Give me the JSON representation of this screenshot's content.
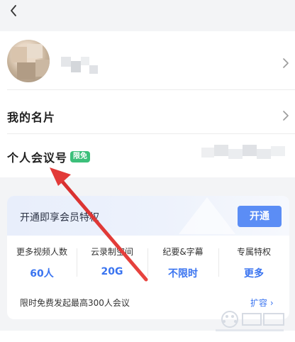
{
  "header": {
    "back_icon": "chevron-left-icon"
  },
  "profile": {
    "name_blurred": true
  },
  "rows": {
    "card_label": "我的名片",
    "meeting_id_label": "个人会议号",
    "meeting_id_badge": "限免"
  },
  "vip": {
    "title": "开通即享会员特权",
    "open_label": "开通",
    "features": [
      {
        "name": "更多视频人数",
        "value": "60人"
      },
      {
        "name": "云录制空间",
        "value": "20G"
      },
      {
        "name": "纪要&字幕",
        "value": "不限时"
      },
      {
        "name": "专属特权",
        "value": "更多"
      }
    ],
    "footer": "限时免费发起最高300人会议",
    "expand_label": "扩容"
  },
  "colors": {
    "accent": "#3a74f0",
    "badge": "#3cbf7a",
    "arrow": "#e33b3b"
  }
}
